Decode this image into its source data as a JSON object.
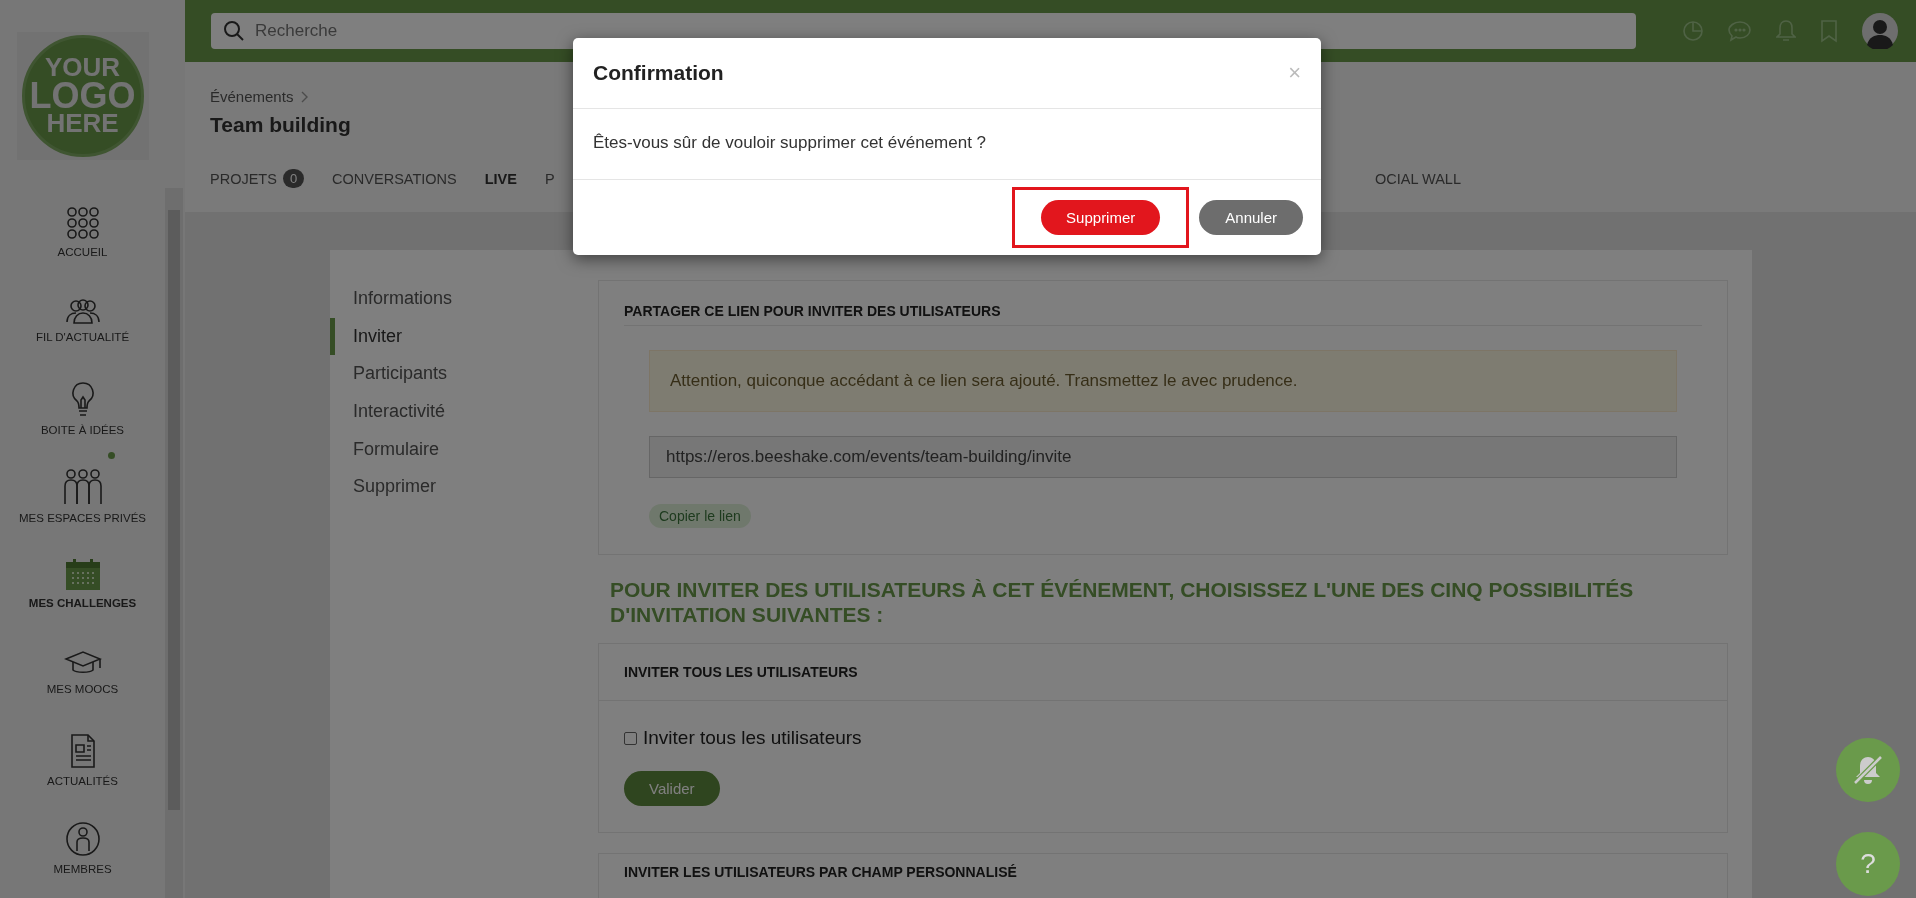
{
  "sidebar": {
    "logo": {
      "lines": [
        "YOUR",
        "LOGO",
        "HERE"
      ]
    },
    "items": [
      {
        "label": "ACCUEIL",
        "selected": false,
        "unread": false
      },
      {
        "label": "FIL D'ACTUALITÉ",
        "selected": false,
        "unread": false
      },
      {
        "label": "BOITE À IDÉES",
        "selected": false,
        "unread": false
      },
      {
        "label": "MES ESPACES PRIVÉS",
        "selected": false,
        "unread": true
      },
      {
        "label": "MES CHALLENGES",
        "selected": true,
        "unread": false
      },
      {
        "label": "MES MOOCS",
        "selected": false,
        "unread": false
      },
      {
        "label": "ACTUALITÉS",
        "selected": false,
        "unread": false
      },
      {
        "label": "MEMBRES",
        "selected": false,
        "unread": false
      }
    ]
  },
  "topbar": {
    "search": {
      "placeholder": "Recherche"
    }
  },
  "header": {
    "breadcrumb": [
      "Événements"
    ],
    "title": "Team building",
    "tabs": [
      {
        "label": "PROJETS",
        "badge": "0",
        "emphasized": false
      },
      {
        "label": "CONVERSATIONS",
        "emphasized": false
      },
      {
        "label": "LIVE",
        "emphasized": true
      },
      {
        "label": "P",
        "emphasized": false
      },
      {
        "label": "OCIAL WALL",
        "emphasized": false
      }
    ]
  },
  "settings_menu": [
    {
      "label": "Informations",
      "selected": false
    },
    {
      "label": "Inviter",
      "selected": true
    },
    {
      "label": "Participants",
      "selected": false
    },
    {
      "label": "Interactivité",
      "selected": false
    },
    {
      "label": "Formulaire",
      "selected": false
    },
    {
      "label": "Supprimer",
      "selected": false
    }
  ],
  "share_link": {
    "title": "PARTAGER CE LIEN POUR INVITER DES UTILISATEURS",
    "warning": "Attention, quiconque accédant à ce lien sera ajouté. Transmettez le avec prudence.",
    "url": "https://eros.beeshake.com/events/team-building/invite",
    "copy_button": "Copier le lien"
  },
  "invite_heading": "POUR INVITER DES UTILISATEURS À CET ÉVÉNEMENT, CHOISISSEZ L'UNE DES CINQ POSSIBILITÉS D'INVITATION SUIVANTES :",
  "invite_all": {
    "title": "INVITER TOUS LES UTILISATEURS",
    "checkbox": {
      "label": "Inviter tous les utilisateurs",
      "checked": false
    },
    "button": "Valider"
  },
  "next_section": {
    "title": "INVITER LES UTILISATEURS PAR CHAMP PERSONNALISÉ"
  },
  "floating_buttons": [
    {
      "kind": "mute"
    },
    {
      "kind": "help",
      "label": "?"
    }
  ],
  "modal": {
    "title": "Confirmation",
    "close": "×",
    "message": "Êtes-vous sûr de vouloir supprimer cet événement ?",
    "buttons": [
      {
        "label": "Supprimer",
        "kind": "danger",
        "highlighted": true
      },
      {
        "label": "Annuler",
        "kind": "secondary",
        "highlighted": false
      }
    ]
  }
}
